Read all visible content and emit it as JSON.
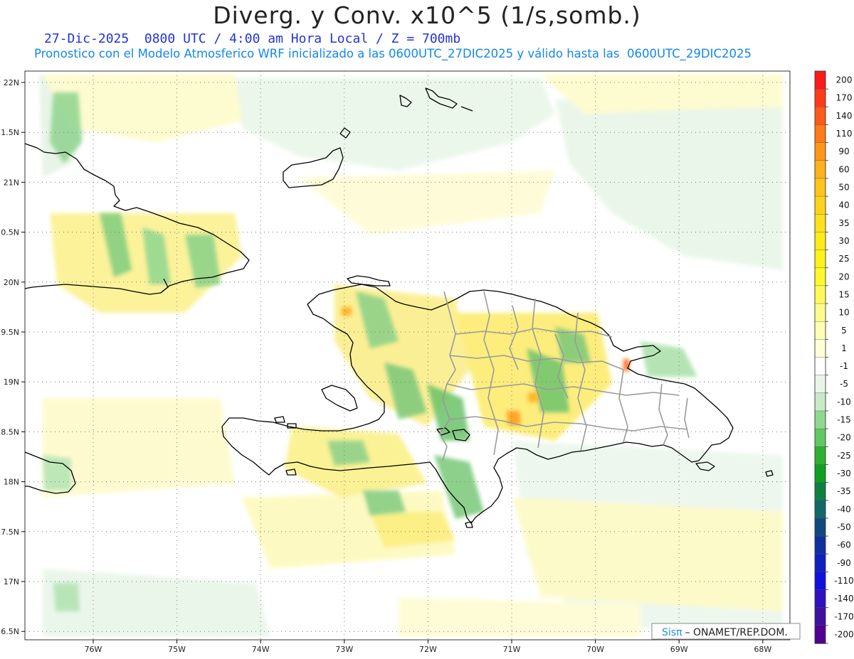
{
  "title": "Diverg. y Conv. x10^5 (1/s,somb.)",
  "subtitle_line1": "27-Dic-2025  0800 UTC / 4:00 am Hora Local / Z = 700mb",
  "subtitle_line2": "Pronostico con el Modelo Atmosferico WRF inicializado a las 0600UTC_27DIC2025 y válido hasta las  0600UTC_29DIC2025",
  "lat_labels": [
    "22N",
    "21.5N",
    "21N",
    "20.5N",
    "20N",
    "19.5N",
    "19N",
    "18.5N",
    "18N",
    "17.5N",
    "17N",
    "16.5N"
  ],
  "lon_labels": [
    "76W",
    "75W",
    "74W",
    "73W",
    "72W",
    "71W",
    "70W",
    "69W",
    "68W"
  ],
  "colorbar": {
    "labels": [
      "200",
      "170",
      "140",
      "110",
      "90",
      "60",
      "50",
      "40",
      "35",
      "30",
      "25",
      "20",
      "15",
      "10",
      "5",
      "1",
      "-1",
      "-5",
      "-10",
      "-15",
      "-20",
      "-25",
      "-30",
      "-35",
      "-40",
      "-50",
      "-60",
      "-90",
      "-110",
      "-140",
      "-170",
      "-200"
    ],
    "colors": [
      "#ff1a1a",
      "#ff3a1a",
      "#ff5a1a",
      "#ff7a1a",
      "#ff961a",
      "#ffb01a",
      "#ffc41a",
      "#ffd21a",
      "#ffe01a",
      "#ffea1a",
      "#fff21a",
      "#fff82a",
      "#fffa5a",
      "#fffc8c",
      "#fffdb4",
      "#fffed6",
      "#ffffff",
      "#e8f5e8",
      "#c8eac8",
      "#90d890",
      "#60c860",
      "#30b030",
      "#10a020",
      "#108040",
      "#106868",
      "#104880",
      "#1030a0",
      "#1020c0",
      "#1010e0",
      "#3010c0",
      "#4010a0",
      "#500090"
    ]
  },
  "credit": {
    "sis": "Sis",
    "pi": "π",
    "rest": "– ONAMET/REP.DOM."
  },
  "colors": {
    "coast": "#000000",
    "provinces": "#9a9a9a",
    "grid": "#777777"
  }
}
